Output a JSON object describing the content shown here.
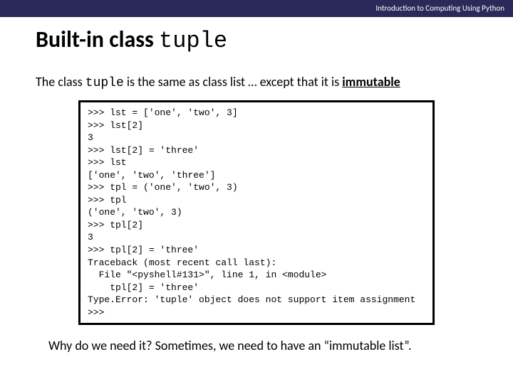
{
  "header": {
    "right_text": "Introduction to Computing Using Python"
  },
  "title": {
    "prefix": "Built-in class ",
    "mono": "tuple"
  },
  "intro": {
    "part1": "The class ",
    "mono": "tuple",
    "part2": " is the same as class list … except that it is ",
    "immutable": "immutable"
  },
  "code": ">>> lst = ['one', 'two', 3]\n>>> lst[2]\n3\n>>> lst[2] = 'three'\n>>> lst\n['one', 'two', 'three']\n>>> tpl = ('one', 'two', 3)\n>>> tpl\n('one', 'two', 3)\n>>> tpl[2]\n3\n>>> tpl[2] = 'three'\nTraceback (most recent call last):\n  File \"<pyshell#131>\", line 1, in <module>\n    tpl[2] = 'three'\nType.Error: 'tuple' object does not support item assignment\n>>>",
  "outro": "Why do we need it?  Sometimes, we need to have an “immutable list”."
}
